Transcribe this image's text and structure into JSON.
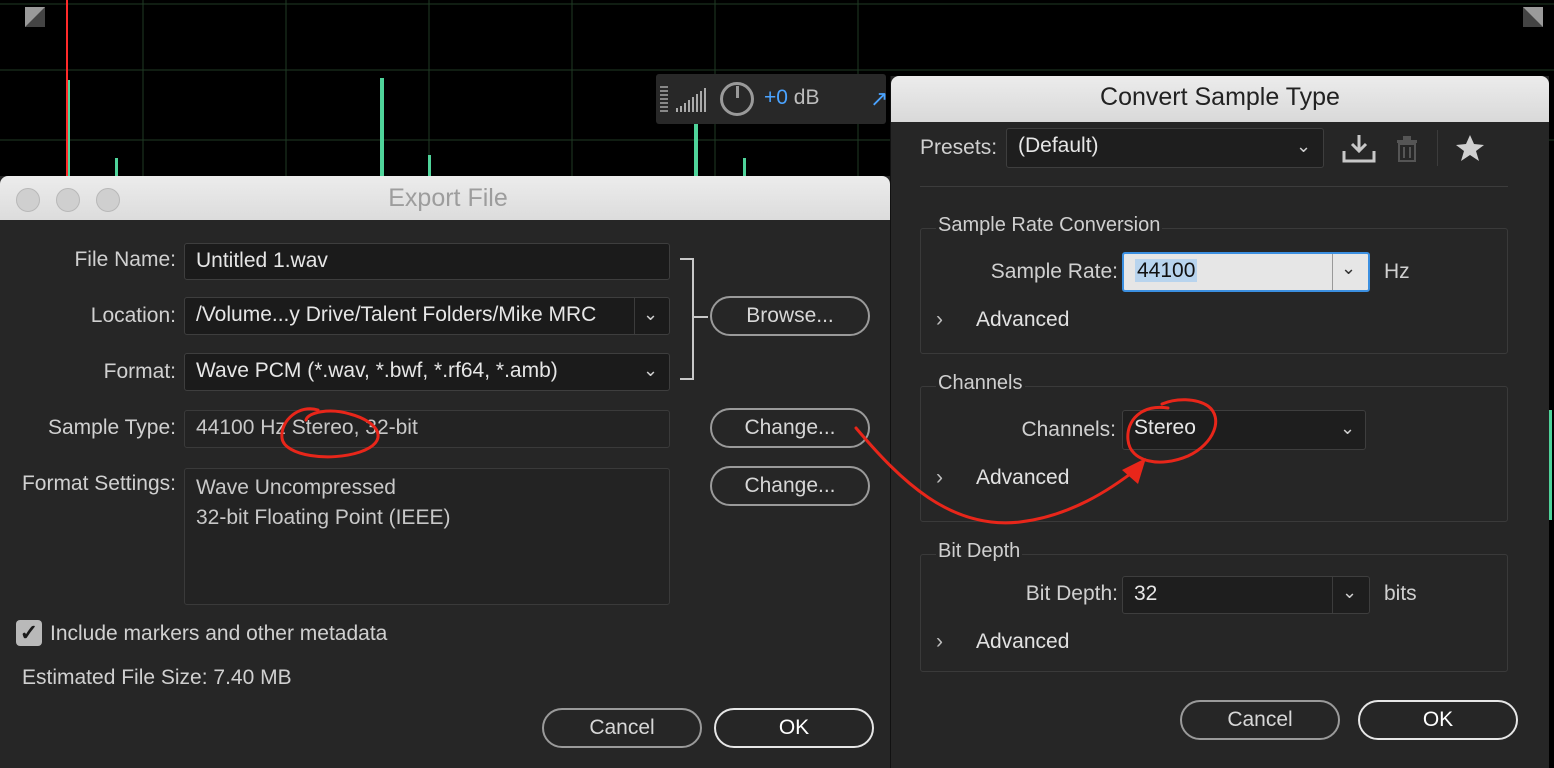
{
  "background": {
    "corner_left_icon": "resize-corner-icon",
    "corner_right_icon": "resize-corner-icon",
    "waveform_color": "#4fd39a",
    "playhead_color": "#ff2a2a"
  },
  "volume_hud": {
    "value": "+0",
    "unit": "dB"
  },
  "export_dialog": {
    "title": "Export File",
    "file_name_label": "File Name:",
    "file_name_value": "Untitled 1.wav",
    "location_label": "Location:",
    "location_value": "/Volume...y Drive/Talent Folders/Mike MRC",
    "format_label": "Format:",
    "format_value": "Wave PCM (*.wav, *.bwf, *.rf64, *.amb)",
    "sample_type_label": "Sample Type:",
    "sample_type_value": "44100 Hz Stereo, 32-bit",
    "format_settings_label": "Format Settings:",
    "format_settings_line1": "Wave Uncompressed",
    "format_settings_line2": "32-bit Floating Point (IEEE)",
    "browse_label": "Browse...",
    "change_sample_label": "Change...",
    "change_format_label": "Change...",
    "include_markers_label": "Include markers and other metadata",
    "include_markers_checked": true,
    "estimated_size": "Estimated File Size: 7.40 MB",
    "cancel_label": "Cancel",
    "ok_label": "OK"
  },
  "convert_dialog": {
    "title": "Convert Sample Type",
    "presets_label": "Presets:",
    "presets_value": "(Default)",
    "sample_rate_group": "Sample Rate Conversion",
    "sample_rate_label": "Sample Rate:",
    "sample_rate_value": "44100",
    "sample_rate_unit": "Hz",
    "advanced_1": "Advanced",
    "channels_group": "Channels",
    "channels_label": "Channels:",
    "channels_value": "Stereo",
    "advanced_2": "Advanced",
    "bit_depth_group": "Bit Depth",
    "bit_depth_label": "Bit Depth:",
    "bit_depth_value": "32",
    "bit_depth_unit": "bits",
    "advanced_3": "Advanced",
    "cancel_label": "Cancel",
    "ok_label": "OK"
  },
  "annotation": {
    "color": "#e8261a"
  }
}
